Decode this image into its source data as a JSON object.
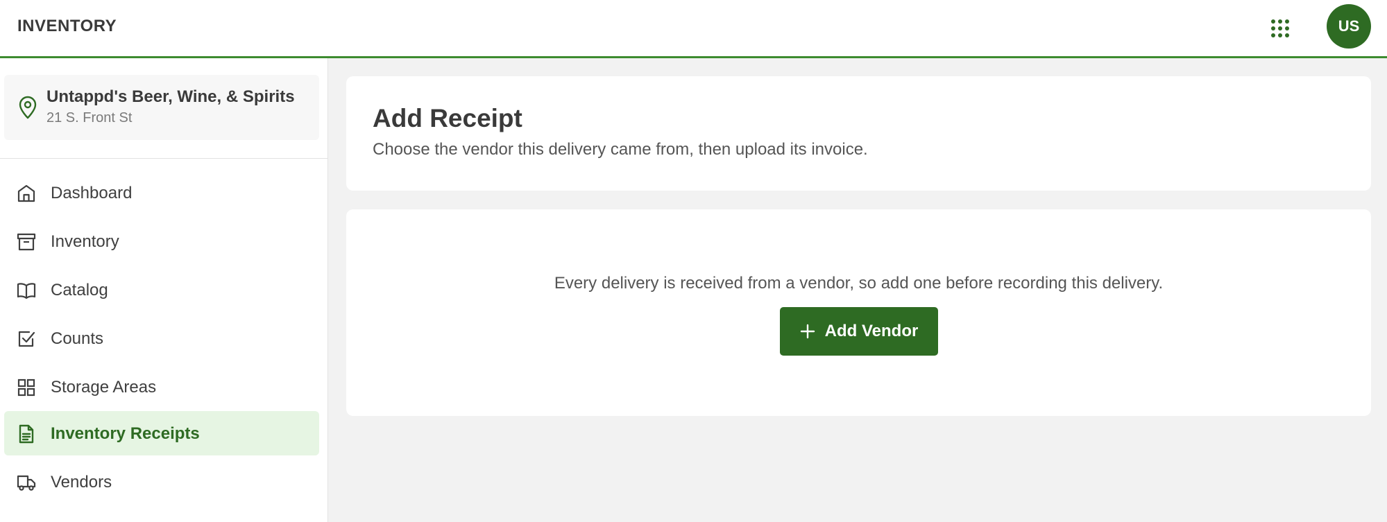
{
  "header": {
    "app_title": "INVENTORY",
    "apps_icon": "grid-dots-icon",
    "avatar_initials": "US"
  },
  "location": {
    "name": "Untappd's Beer, Wine, & Spirits",
    "address": "21 S. Front St",
    "icon": "map-pin-icon"
  },
  "sidebar": {
    "items": [
      {
        "label": "Dashboard",
        "icon": "home-icon",
        "active": false
      },
      {
        "label": "Inventory",
        "icon": "archive-box-icon",
        "active": false
      },
      {
        "label": "Catalog",
        "icon": "open-book-icon",
        "active": false
      },
      {
        "label": "Counts",
        "icon": "checkbox-icon",
        "active": false
      },
      {
        "label": "Storage Areas",
        "icon": "grid-icon",
        "active": false
      },
      {
        "label": "Inventory Receipts",
        "icon": "document-icon",
        "active": true
      },
      {
        "label": "Vendors",
        "icon": "truck-icon",
        "active": false
      }
    ]
  },
  "main": {
    "title": "Add Receipt",
    "subtitle": "Choose the vendor this delivery came from, then upload its invoice.",
    "empty_message": "Every delivery is received from a vendor, so add one before recording this delivery.",
    "add_vendor_label": "Add Vendor"
  },
  "colors": {
    "accent": "#2e6b23",
    "accent_light": "#e6f5e3",
    "header_border": "#3d8b2f",
    "background": "#f2f2f2"
  }
}
